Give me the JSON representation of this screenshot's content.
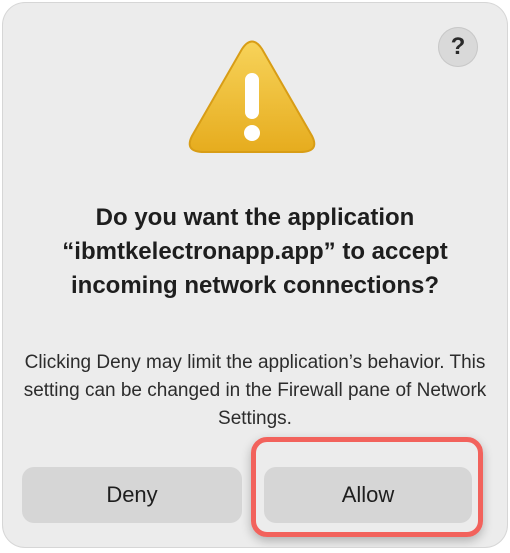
{
  "dialog": {
    "help_glyph": "?",
    "title": "Do you want the application “ibmtkelectronapp.app” to accept incoming network connections?",
    "message": "Clicking Deny may limit the application’s behavior. This setting can be changed in the Firewall pane of Network Settings.",
    "deny_label": "Deny",
    "allow_label": "Allow",
    "icon": "warning-icon",
    "colors": {
      "dialog_bg": "#ececec",
      "button_bg": "#d6d6d6",
      "warning_yellow": "#f2c744",
      "highlight": "#f2625c"
    }
  }
}
